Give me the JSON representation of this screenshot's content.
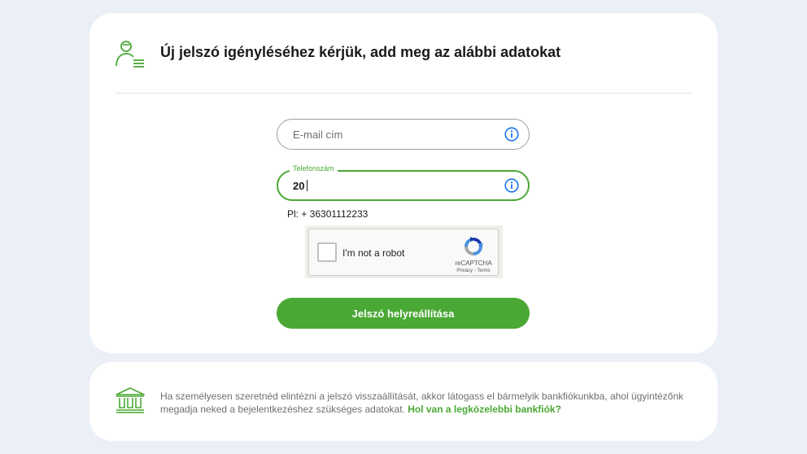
{
  "form": {
    "title": "Új jelszó igényléséhez kérjük, add meg az alábbi adatokat",
    "email": {
      "placeholder": "E-mail cím"
    },
    "phone": {
      "label": "Telefonszám",
      "value": "20"
    },
    "phone_hint": "Pl: + 36301112233",
    "captcha": {
      "label": "I'm not a robot",
      "brand": "reCAPTCHA",
      "links": "Privacy - Terms"
    },
    "submit_label": "Jelszó helyreállítása"
  },
  "info": {
    "text_main": "Ha személyesen szeretnéd elintézni a jelszó visszaállítását, akkor látogass el bármelyik bankfiókunkba, ahol ügyintézőnk megadja neked  a bejelentkezéshez szükséges adatokat.",
    "link_label": "Hol van a legközelebbi bankfiók?"
  },
  "colors": {
    "accent": "#4aa834",
    "info_icon": "#1a73e8",
    "background": "#ebeff6"
  },
  "icons": {
    "header": "user-list-icon",
    "field_info": "info-icon",
    "branch": "bank-icon"
  }
}
